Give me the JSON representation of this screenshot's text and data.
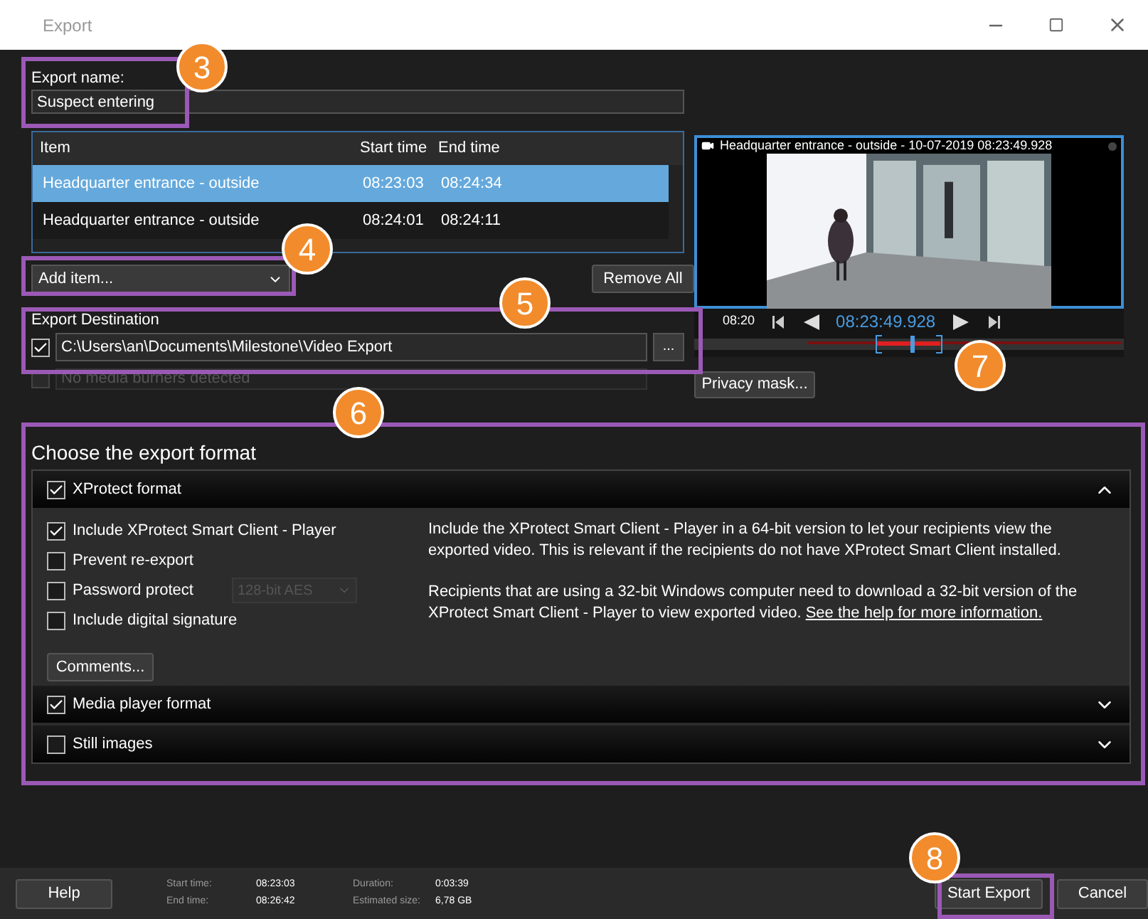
{
  "window": {
    "title": "Export"
  },
  "export_name": {
    "label": "Export name:",
    "value": "Suspect entering"
  },
  "items_table": {
    "columns": [
      "Item",
      "Start time",
      "End time"
    ],
    "rows": [
      {
        "item": "Headquarter entrance - outside",
        "start": "08:23:03",
        "end": "08:24:34",
        "selected": true
      },
      {
        "item": "Headquarter entrance - outside",
        "start": "08:24:01",
        "end": "08:24:11",
        "selected": false
      }
    ]
  },
  "add_item": "Add item...",
  "remove_all": "Remove All",
  "destination": {
    "label": "Export Destination",
    "checked": true,
    "path": "C:\\Users\\an\\Documents\\Milestone\\Video Export",
    "browse": "..."
  },
  "burner": {
    "checked": false,
    "disabled": true,
    "placeholder": "No media burners detected"
  },
  "preview": {
    "title": "Headquarter entrance - outside - 10-07-2019 08:23:49.928",
    "tick": "08:20",
    "time": "08:23:49.928"
  },
  "privacy_mask": "Privacy mask...",
  "format": {
    "heading": "Choose the export format",
    "sections": [
      {
        "label": "XProtect format",
        "checked": true,
        "expanded": true
      },
      {
        "label": "Media player format",
        "checked": true,
        "expanded": false
      },
      {
        "label": "Still images",
        "checked": false,
        "expanded": false
      }
    ]
  },
  "xprotect_options": [
    {
      "label": "Include XProtect Smart Client - Player",
      "checked": true
    },
    {
      "label": "Prevent re-export",
      "checked": false
    },
    {
      "label": "Password protect",
      "checked": false
    },
    {
      "label": "Include digital signature",
      "checked": false
    }
  ],
  "encryption": {
    "value": "128-bit AES",
    "disabled": true
  },
  "comments": "Comments...",
  "description": [
    "Include the XProtect Smart Client - Player in a 64-bit version to let your recipients view the exported video. This is relevant if the recipients do not have XProtect Smart Client installed.",
    "Recipients that are using a 32-bit Windows computer need to download a 32-bit version of the XProtect Smart Client - Player to view exported video."
  ],
  "help_link": "See the help for more information.",
  "footer": {
    "help": "Help",
    "stats": [
      {
        "label": "Start time:",
        "value": "08:23:03"
      },
      {
        "label": "End time:",
        "value": "08:26:42"
      },
      {
        "label": "Duration:",
        "value": "0:03:39"
      },
      {
        "label": "Estimated size:",
        "value": "6,78 GB"
      }
    ],
    "start_export": "Start Export",
    "cancel": "Cancel"
  },
  "callouts": [
    "3",
    "4",
    "5",
    "6",
    "7",
    "8"
  ]
}
